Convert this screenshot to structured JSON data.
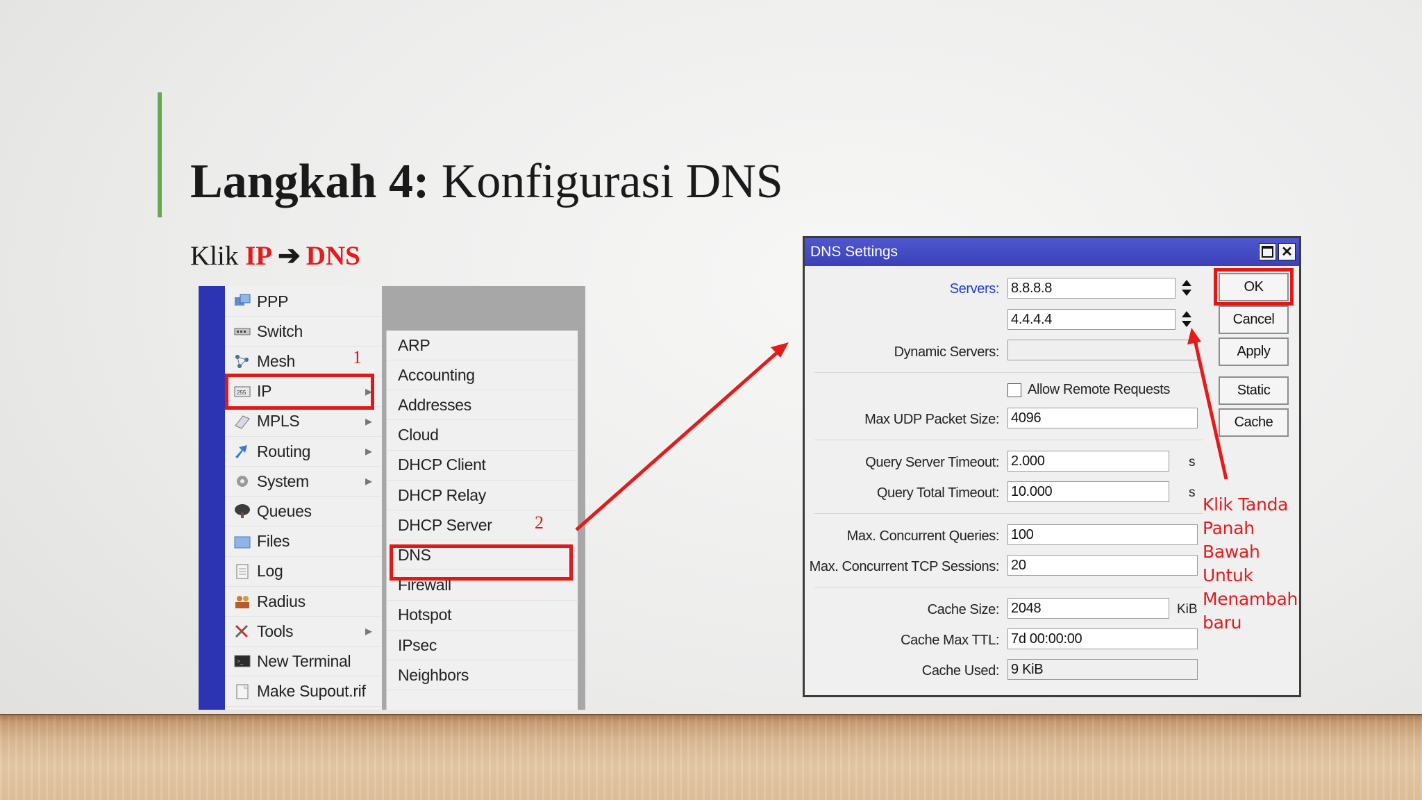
{
  "slide": {
    "title_bold": "Langkah 4:",
    "title_rest": " Konfigurasi DNS",
    "instruction": {
      "prefix": "Klik ",
      "first": "IP",
      "arrow": "➔",
      "second": "DNS"
    }
  },
  "menu": {
    "main_items": [
      {
        "label": "PPP",
        "icon": "ppp-icon",
        "submenu": false
      },
      {
        "label": "Switch",
        "icon": "switch-icon",
        "submenu": false
      },
      {
        "label": "Mesh",
        "icon": "mesh-icon",
        "submenu": false
      },
      {
        "label": "IP",
        "icon": "ip-icon",
        "submenu": true
      },
      {
        "label": "MPLS",
        "icon": "mpls-icon",
        "submenu": true
      },
      {
        "label": "Routing",
        "icon": "routing-icon",
        "submenu": true
      },
      {
        "label": "System",
        "icon": "gear-icon",
        "submenu": true
      },
      {
        "label": "Queues",
        "icon": "queues-icon",
        "submenu": false
      },
      {
        "label": "Files",
        "icon": "folder-icon",
        "submenu": false
      },
      {
        "label": "Log",
        "icon": "log-icon",
        "submenu": false
      },
      {
        "label": "Radius",
        "icon": "radius-icon",
        "submenu": false
      },
      {
        "label": "Tools",
        "icon": "tools-icon",
        "submenu": true
      },
      {
        "label": "New Terminal",
        "icon": "terminal-icon",
        "submenu": false
      },
      {
        "label": "Make Supout.rif",
        "icon": "supout-icon",
        "submenu": false
      }
    ],
    "sub_items": [
      "ARP",
      "Accounting",
      "Addresses",
      "Cloud",
      "DHCP Client",
      "DHCP Relay",
      "DHCP Server",
      "DNS",
      "Firewall",
      "Hotspot",
      "IPsec",
      "Neighbors"
    ],
    "step1": "1",
    "step2": "2",
    "submenu_marker": "▸"
  },
  "dialog": {
    "title": "DNS Settings",
    "servers_label": "Servers:",
    "server1": "8.8.8.8",
    "server2": "4.4.4.4",
    "dynamic_servers_label": "Dynamic Servers:",
    "dynamic_servers": "",
    "allow_remote_label": "Allow Remote Requests",
    "allow_remote_checked": false,
    "max_udp_label": "Max UDP Packet Size:",
    "max_udp": "4096",
    "query_server_timeout_label": "Query Server Timeout:",
    "query_server_timeout": "2.000",
    "query_total_timeout_label": "Query Total Timeout:",
    "query_total_timeout": "10.000",
    "seconds_unit": "s",
    "max_conc_queries_label": "Max. Concurrent Queries:",
    "max_conc_queries": "100",
    "max_conc_tcp_label": "Max. Concurrent TCP Sessions:",
    "max_conc_tcp": "20",
    "cache_size_label": "Cache Size:",
    "cache_size": "2048",
    "kib_unit": "KiB",
    "cache_max_ttl_label": "Cache Max TTL:",
    "cache_max_ttl": "7d 00:00:00",
    "cache_used_label": "Cache Used:",
    "cache_used": "9 KiB",
    "buttons": {
      "ok": "OK",
      "cancel": "Cancel",
      "apply": "Apply",
      "static": "Static",
      "cache": "Cache"
    }
  },
  "annotation": [
    "Klik Tanda",
    "Panah",
    "Bawah",
    "Untuk",
    "Menambah",
    "baru"
  ],
  "colors": {
    "accent_green": "#6aa84f",
    "highlight_red": "#e01818",
    "title_bar_blue": "#3a41b8",
    "winbox_side_blue": "#2c34b4"
  }
}
